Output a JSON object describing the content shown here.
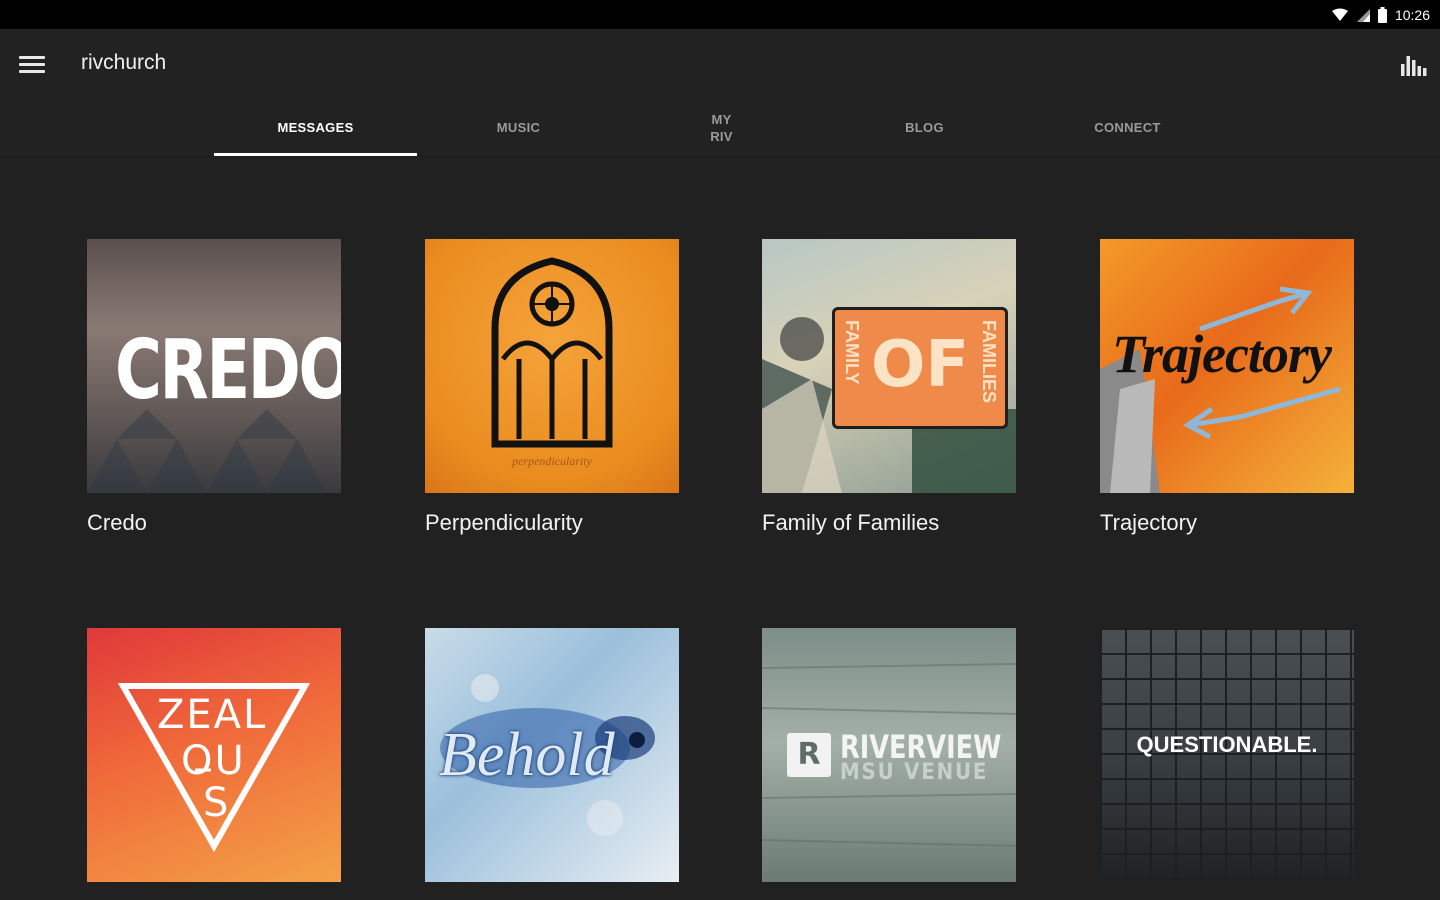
{
  "status": {
    "time": "10:26"
  },
  "appbar": {
    "title": "rivchurch"
  },
  "tabs": [
    {
      "label": "MESSAGES",
      "active": true
    },
    {
      "label": "MUSIC"
    },
    {
      "label": "MY RIV"
    },
    {
      "label": "BLOG"
    },
    {
      "label": "CONNECT"
    }
  ],
  "series": [
    {
      "title": "Credo",
      "art_text": "CREDO."
    },
    {
      "title": "Perpendicularity",
      "art_text": "perpendicularity"
    },
    {
      "title": "Family of Families",
      "art_text": "OF",
      "art_side_left": "FAMILY",
      "art_side_right": "FAMILIES"
    },
    {
      "title": "Trajectory",
      "art_text": "Trajectory"
    },
    {
      "title": "",
      "art_text_1": "ZEAL",
      "art_text_2": "OU",
      "art_text_3": "S"
    },
    {
      "title": "",
      "art_text": "Behold"
    },
    {
      "title": "",
      "art_text": "RIVERVIEW",
      "art_sub": "MSU VENUE",
      "art_logo": "R"
    },
    {
      "title": "",
      "art_text": "QUESTIONABLE."
    }
  ],
  "colors": {
    "background": "#212121",
    "accent": "#ffffff",
    "tab_inactive": "#9a9a9a"
  }
}
